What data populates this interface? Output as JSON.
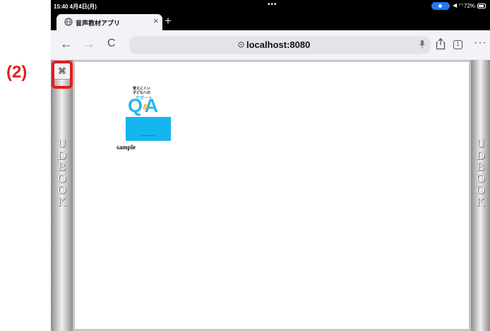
{
  "annotation": {
    "callout_label": "(2)",
    "callout_color": "#e31d1d"
  },
  "status_bar": {
    "time": "15:40  4月4日(月)",
    "battery": "72%"
  },
  "tab": {
    "title": "音声教材アプリ",
    "close": "×",
    "new_tab": "+"
  },
  "nav": {
    "back": "←",
    "forward": "→",
    "reload": "C",
    "url": "localhost:8080",
    "tabs_count": "1",
    "more": "···"
  },
  "page": {
    "menu_button_glyph": "⌘",
    "side_text_left": "UDBOOK",
    "side_text_right": "UDBOOK",
    "books": [
      {
        "title": "sample",
        "cover": {
          "top_line_1": "覚えにくい",
          "top_line_2": "子どもへの",
          "support": "サポート",
          "qa": "Q A",
          "amp": "&"
        }
      }
    ]
  }
}
